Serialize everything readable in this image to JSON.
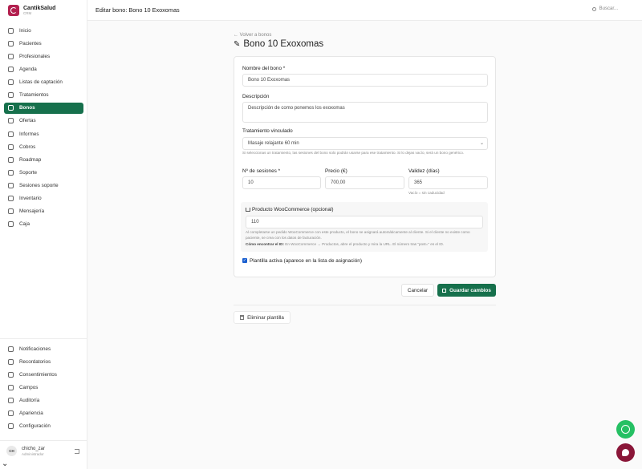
{
  "brand": {
    "name": "CantikSalud",
    "sub": "CRM"
  },
  "sidebar": {
    "items": [
      {
        "label": "Inicio"
      },
      {
        "label": "Pacientes"
      },
      {
        "label": "Profesionales"
      },
      {
        "label": "Agenda"
      },
      {
        "label": "Listas de captación"
      },
      {
        "label": "Tratamientos"
      },
      {
        "label": "Bonos"
      },
      {
        "label": "Ofertas"
      },
      {
        "label": "Informes"
      },
      {
        "label": "Cobros"
      },
      {
        "label": "Roadmap"
      },
      {
        "label": "Soporte"
      },
      {
        "label": "Sesiones soporte"
      },
      {
        "label": "Inventario"
      },
      {
        "label": "Mensajería"
      },
      {
        "label": "Caja"
      }
    ],
    "bottom_items": [
      {
        "label": "Notificaciones"
      },
      {
        "label": "Recordatorios"
      },
      {
        "label": "Consentimientos"
      },
      {
        "label": "Campos"
      },
      {
        "label": "Auditoría"
      },
      {
        "label": "Apariencia"
      },
      {
        "label": "Configuración"
      }
    ],
    "active": "Bonos"
  },
  "user": {
    "initials": "CH",
    "name": "chicho_zar",
    "role": "Administrador"
  },
  "topbar": {
    "title": "Editar bono: Bono 10 Exoxomas",
    "search_placeholder": "Buscar..."
  },
  "page": {
    "back_label": "← Volver a bonos",
    "title": "Bono 10 Exoxomas"
  },
  "form": {
    "name_label": "Nombre del bono *",
    "name_value": "Bono 10 Exoxomas",
    "desc_label": "Descripción",
    "desc_value": "Descripción de como ponemos los exoxomas",
    "treatment_label": "Tratamiento vinculado",
    "treatment_value": "Masaje relajante 60 min",
    "treatment_hint": "Si seleccionas un tratamiento, las sesiones del bono solo podrán usarse para ese tratamiento. Si lo dejas vacío, será un bono genérico.",
    "sessions_label": "Nº de sesiones *",
    "sessions_value": "10",
    "price_label": "Precio (€)",
    "price_value": "700,00",
    "validity_label": "Validez (días)",
    "validity_value": "365",
    "validity_hint": "Vacío = sin caducidad",
    "woo_label": "Producto WooCommerce (opcional)",
    "woo_value": "110",
    "woo_hint": "Al completarse un pedido WooCommerce con este producto, el bono se asignará automáticamente al cliente. Si el cliente no existe como paciente, se crea con los datos de facturación.",
    "woo_hint2_bold": "Cómo encontrar el ID:",
    "woo_hint2": " En WooCommerce → Productos, abre el producto y mira la URL. El número tras \"post=\" es el ID.",
    "active_label": "Plantilla activa (aparece en la lista de asignación)",
    "active_checked": true
  },
  "buttons": {
    "cancel": "Cancelar",
    "save": "Guardar cambios",
    "delete": "Eliminar plantilla"
  },
  "colors": {
    "brand": "#b3204f",
    "primary": "#16704c",
    "whatsapp": "#25c063",
    "chat": "#8a1638"
  }
}
